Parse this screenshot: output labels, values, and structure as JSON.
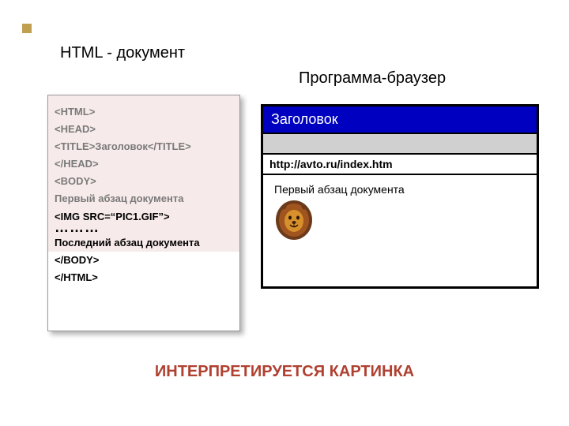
{
  "labels": {
    "left": "HTML - документ",
    "right": "Программа-браузер"
  },
  "code": {
    "l1": "<HTML>",
    "l2": "<HEAD>",
    "l3a": "<TITLE>",
    "l3b": "Заголовок",
    "l3c": "</TITLE>",
    "l4": "</HEAD>",
    "l5": "<BODY>",
    "l6": "Первый абзац документа",
    "l7": "<IMG SRC=“PIC1.GIF”>",
    "l8": "………",
    "l9": "Последний абзац документа",
    "l10": "</BODY>",
    "l11": "</HTML>"
  },
  "browser": {
    "title": "Заголовок",
    "url": "http://avto.ru/index.htm",
    "body_text": "Первый абзац документа"
  },
  "caption": "ИНТЕРПРЕТИРУЕТСЯ КАРТИНКА"
}
